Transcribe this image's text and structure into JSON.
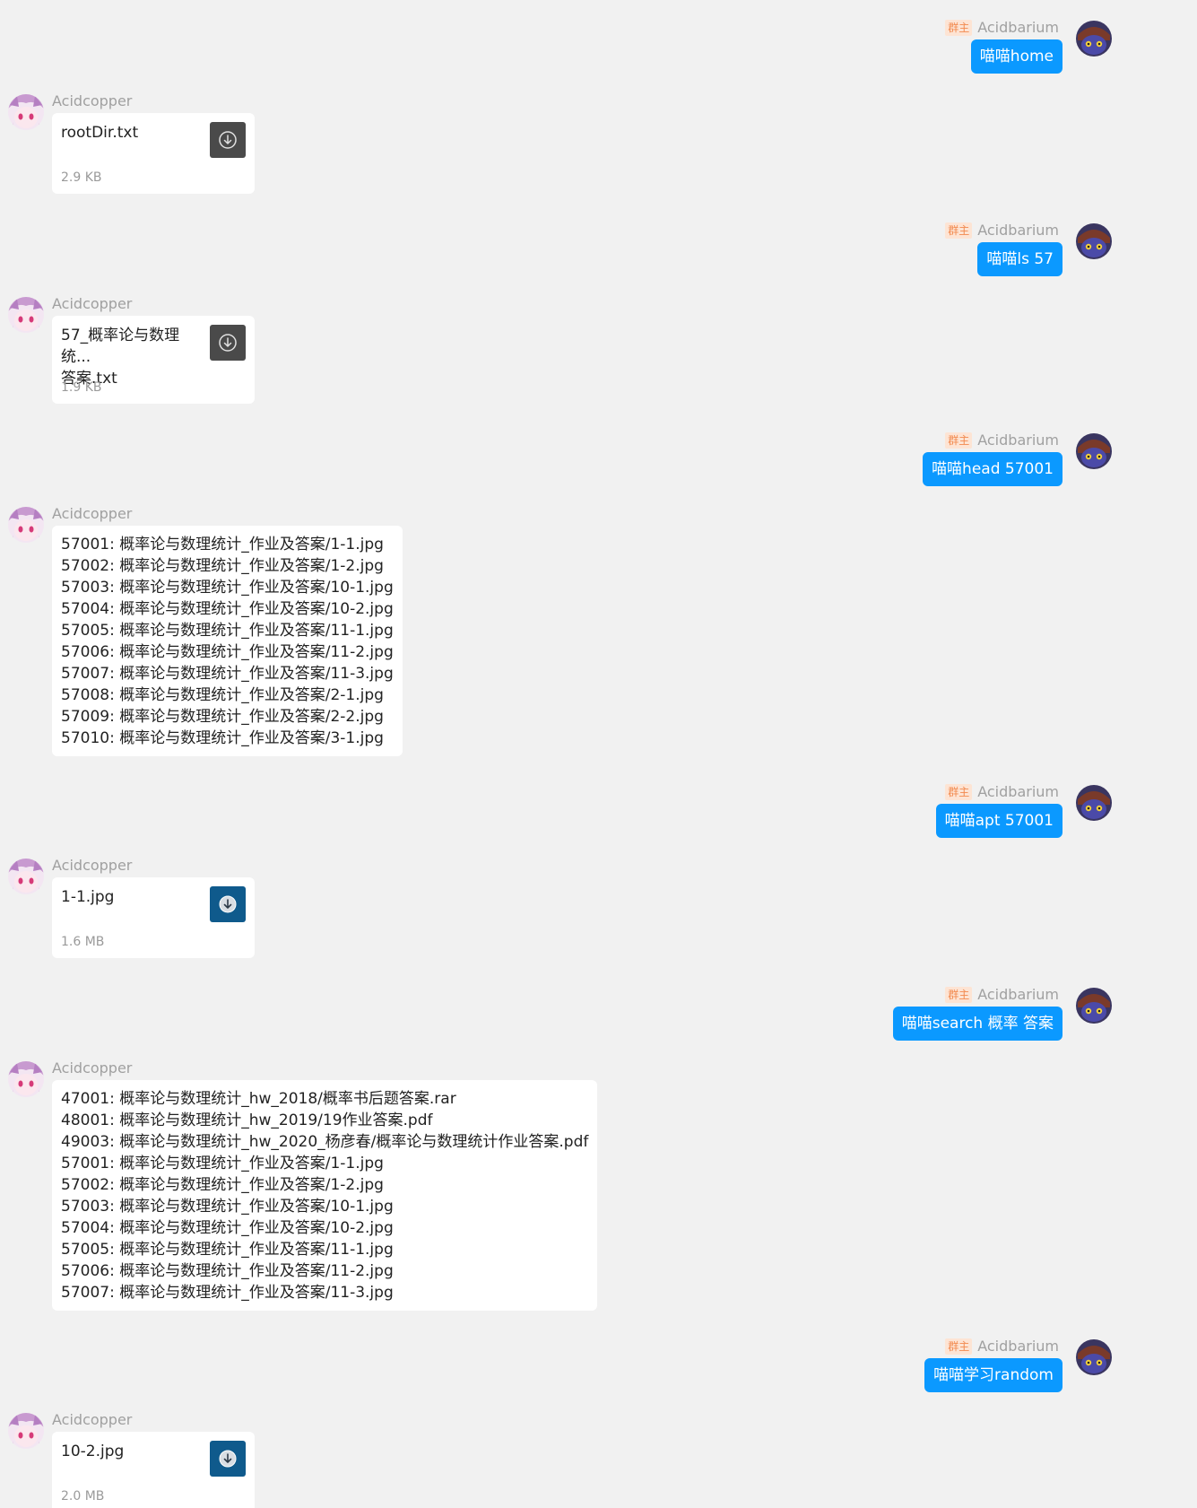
{
  "users": {
    "sender": {
      "name": "Acidbarium",
      "badge": "群主"
    },
    "receiver": {
      "name": "Acidcopper"
    }
  },
  "messages": [
    {
      "side": "out",
      "name": "Acidbarium",
      "badge": "群主",
      "text": "喵喵home"
    },
    {
      "side": "in",
      "name": "Acidcopper",
      "kind": "file",
      "file_name": "rootDir.txt",
      "file_size": "2.9 KB",
      "icon": "download-icon"
    },
    {
      "side": "out",
      "name": "Acidbarium",
      "badge": "群主",
      "text": "喵喵ls 57"
    },
    {
      "side": "in",
      "name": "Acidcopper",
      "kind": "file",
      "file_name": "57_概率论与数理统...\n答案.txt",
      "file_size": "1.9 KB",
      "icon": "download-icon"
    },
    {
      "side": "out",
      "name": "Acidbarium",
      "badge": "群主",
      "text": "喵喵head 57001"
    },
    {
      "side": "in",
      "name": "Acidcopper",
      "kind": "text",
      "lines": [
        "57001: 概率论与数理统计_作业及答案/1-1.jpg",
        "57002: 概率论与数理统计_作业及答案/1-2.jpg",
        "57003: 概率论与数理统计_作业及答案/10-1.jpg",
        "57004: 概率论与数理统计_作业及答案/10-2.jpg",
        "57005: 概率论与数理统计_作业及答案/11-1.jpg",
        "57006: 概率论与数理统计_作业及答案/11-2.jpg",
        "57007: 概率论与数理统计_作业及答案/11-3.jpg",
        "57008: 概率论与数理统计_作业及答案/2-1.jpg",
        "57009: 概率论与数理统计_作业及答案/2-2.jpg",
        "57010: 概率论与数理统计_作业及答案/3-1.jpg"
      ]
    },
    {
      "side": "out",
      "name": "Acidbarium",
      "badge": "群主",
      "text": "喵喵apt 57001"
    },
    {
      "side": "in",
      "name": "Acidcopper",
      "kind": "file",
      "file_name": "1-1.jpg",
      "file_size": "1.6 MB",
      "icon": "download-icon"
    },
    {
      "side": "out",
      "name": "Acidbarium",
      "badge": "群主",
      "text": "喵喵search 概率 答案"
    },
    {
      "side": "in",
      "name": "Acidcopper",
      "kind": "text",
      "lines": [
        "47001: 概率论与数理统计_hw_2018/概率书后题答案.rar",
        "48001: 概率论与数理统计_hw_2019/19作业答案.pdf",
        "49003: 概率论与数理统计_hw_2020_杨彦春/概率论与数理统计作业答案.pdf",
        "57001: 概率论与数理统计_作业及答案/1-1.jpg",
        "57002: 概率论与数理统计_作业及答案/1-2.jpg",
        "57003: 概率论与数理统计_作业及答案/10-1.jpg",
        "57004: 概率论与数理统计_作业及答案/10-2.jpg",
        "57005: 概率论与数理统计_作业及答案/11-1.jpg",
        "57006: 概率论与数理统计_作业及答案/11-2.jpg",
        "57007: 概率论与数理统计_作业及答案/11-3.jpg"
      ]
    },
    {
      "side": "out",
      "name": "Acidbarium",
      "badge": "群主",
      "text": "喵喵学习random"
    },
    {
      "side": "in",
      "name": "Acidcopper",
      "kind": "file",
      "file_name": "10-2.jpg",
      "file_size": "2.0 MB",
      "icon": "download-icon"
    }
  ],
  "colors": {
    "background": "#f1f1f1",
    "bubble_out": "#0b99ff",
    "badge_bg": "#fde4d4",
    "badge_text": "#f28a4f",
    "download_dark": "#4a4a4a",
    "download_blue": "#0f5a8c"
  }
}
